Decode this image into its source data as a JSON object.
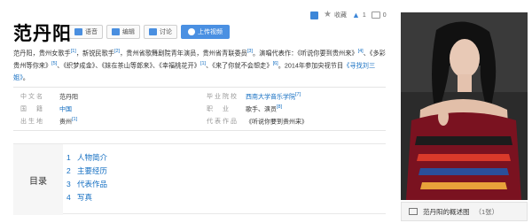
{
  "title": "范丹阳",
  "toolbar": {
    "voice": "语音",
    "edit": "编辑",
    "discuss": "讨论",
    "upload_video": "上传视频"
  },
  "actions": {
    "collect": "收藏",
    "like_count": "1",
    "share_count": "0"
  },
  "summary": {
    "p1": "范丹阳，贵州女歌手",
    "r1": "[1]",
    "p2": "，新锐民歌手",
    "r2": "[2]",
    "p3": "，贵州省歌舞剧院青年演员，贵州省青联委员",
    "r3": "[3]",
    "p4": "。演唱代表作：《听说你要到贵州来》",
    "r4": "[4]",
    "p5": "、《多彩贵州等你来》",
    "r5": "[5]",
    "p6": "、《织梦成金》、《妹在茶山等郎来》、《幸福桃花开》",
    "r6": "[1]",
    "p7": "、《来了你就不会想走》",
    "r7": "[6]",
    "p8": "。2014年参加央视节目",
    "link": "《寻找刘三姐》",
    "p9": "。"
  },
  "info": {
    "rows": [
      {
        "l1": "中文名",
        "v1": "范丹阳",
        "r1": "",
        "l2": "毕业院校",
        "v2": "西南大学音乐学院",
        "r2": "[7]"
      },
      {
        "l1": "国　籍",
        "v1": "中国",
        "r1": "",
        "l2": "职　业",
        "v2": "歌手、演员",
        "r2": "[8]"
      },
      {
        "l1": "出生地",
        "v1": "贵州",
        "r1": "[1]",
        "l2": "代表作品",
        "v2": "《听说你要到贵州来》",
        "r2": ""
      }
    ]
  },
  "toc": {
    "heading": "目录",
    "items": [
      {
        "num": "1",
        "label": "人物简介"
      },
      {
        "num": "2",
        "label": "主要经历"
      },
      {
        "num": "3",
        "label": "代表作品"
      },
      {
        "num": "4",
        "label": "写真"
      }
    ]
  },
  "photo": {
    "caption": "范丹阳的概述图",
    "count": "（1张）"
  },
  "colors": {
    "link": "#136ec2",
    "primary_button": "#4a90e2"
  }
}
